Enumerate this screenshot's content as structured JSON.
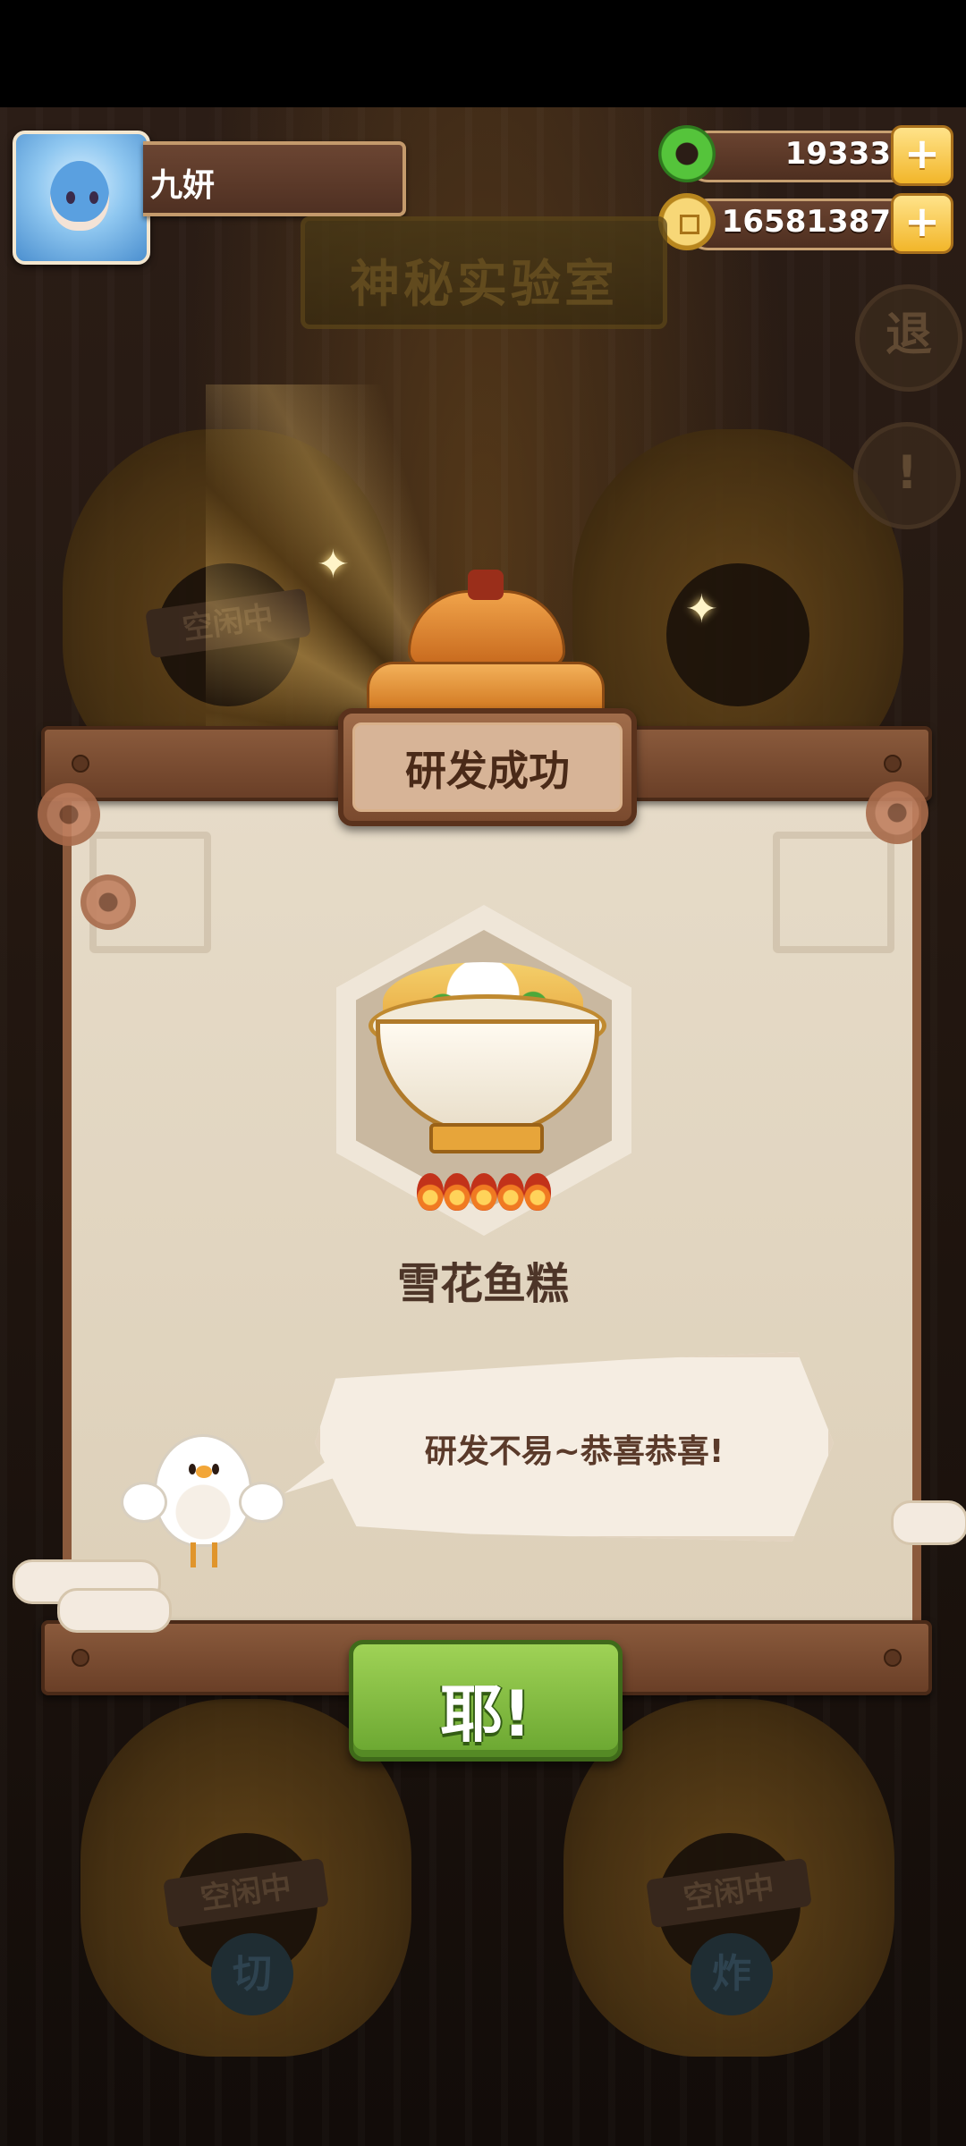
{
  "player": {
    "name": "九妍"
  },
  "currency": {
    "jade": "19333",
    "coins": "16581387"
  },
  "header": {
    "room_title": "神秘实验室",
    "exit_label": "退",
    "info_label": "!"
  },
  "background": {
    "pot_status": [
      "空闲中",
      "空闲中",
      "空闲中",
      "空闲中"
    ],
    "stations": [
      "切",
      "炸"
    ]
  },
  "dialog": {
    "banner": "研发成功",
    "dish_name": "雪花鱼糕",
    "flame_rating": 5,
    "speech": "研发不易~恭喜恭喜!",
    "confirm_label": "耶!"
  },
  "colors": {
    "confirm_green": "#7fbf3c",
    "banner_brown": "#7a4a2e",
    "paper": "#e3d7c3"
  }
}
